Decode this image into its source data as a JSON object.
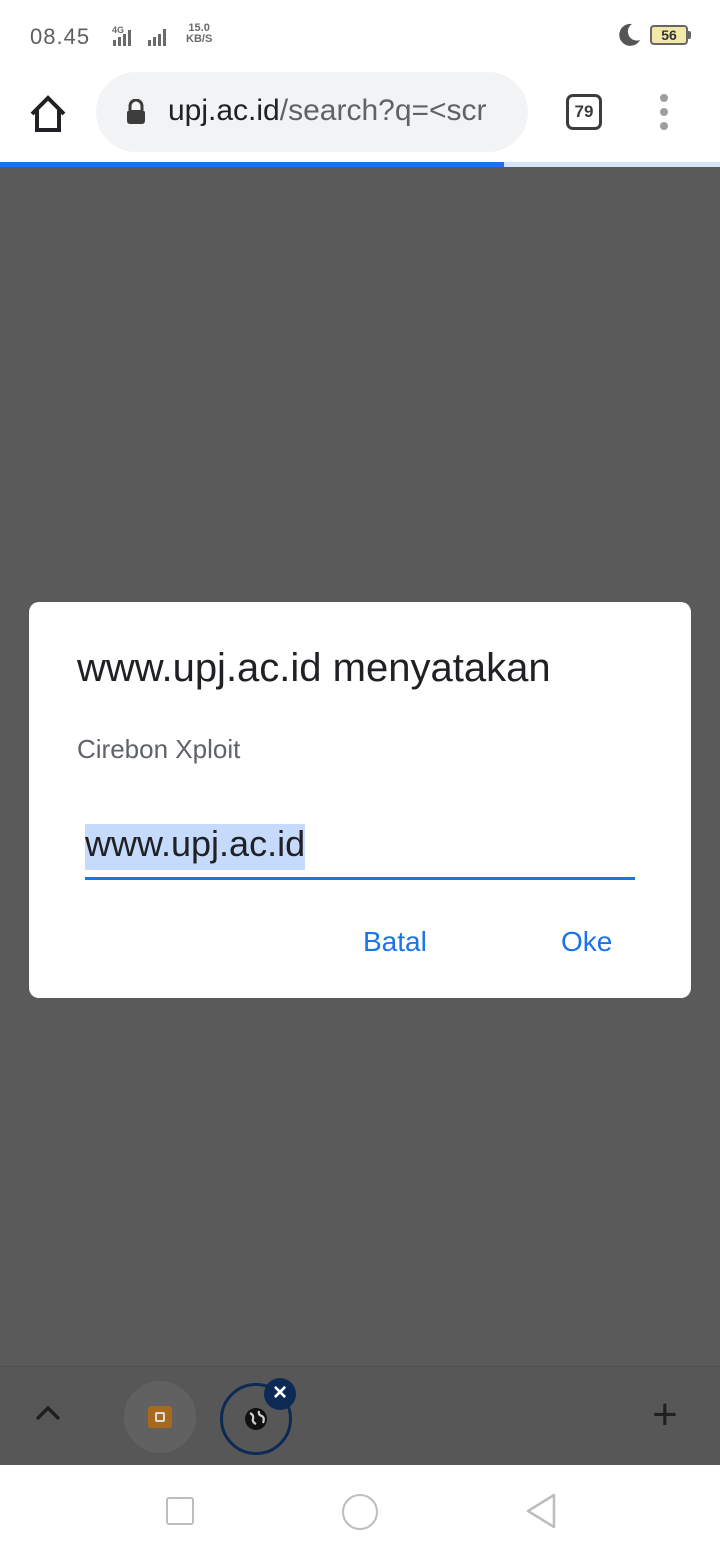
{
  "status_bar": {
    "time": "08.45",
    "network": "4G",
    "speed_value": "15.0",
    "speed_unit": "KB/S",
    "battery": "56",
    "icons": [
      "network-4g-icon",
      "signal-icon",
      "moon-icon",
      "battery-icon"
    ]
  },
  "toolbar": {
    "url_host": "upj.ac.id",
    "url_path": "/search?q=<scr",
    "tab_count": "79",
    "page_load_progress": 0.7,
    "icons": [
      "home-icon",
      "lock-icon",
      "overflow-menu-icon"
    ]
  },
  "dialog": {
    "title": "www.upj.ac.id menyatakan",
    "message": "Cirebon Xploit",
    "input_value": "www.upj.ac.id",
    "cancel_label": "Batal",
    "ok_label": "Oke"
  },
  "tab_strip": {
    "icons": [
      "chevron-up-icon",
      "blogger-favicon",
      "globe-favicon",
      "close-icon",
      "plus-icon"
    ],
    "close_label": "×",
    "plus_label": "+"
  },
  "nav_bar": {
    "icons": [
      "recents-icon",
      "home-circle-icon",
      "back-icon"
    ]
  },
  "colors": {
    "accent": "#1a73e8",
    "scrim": "#5a5a5a",
    "tab_ring": "#0d2a55"
  }
}
